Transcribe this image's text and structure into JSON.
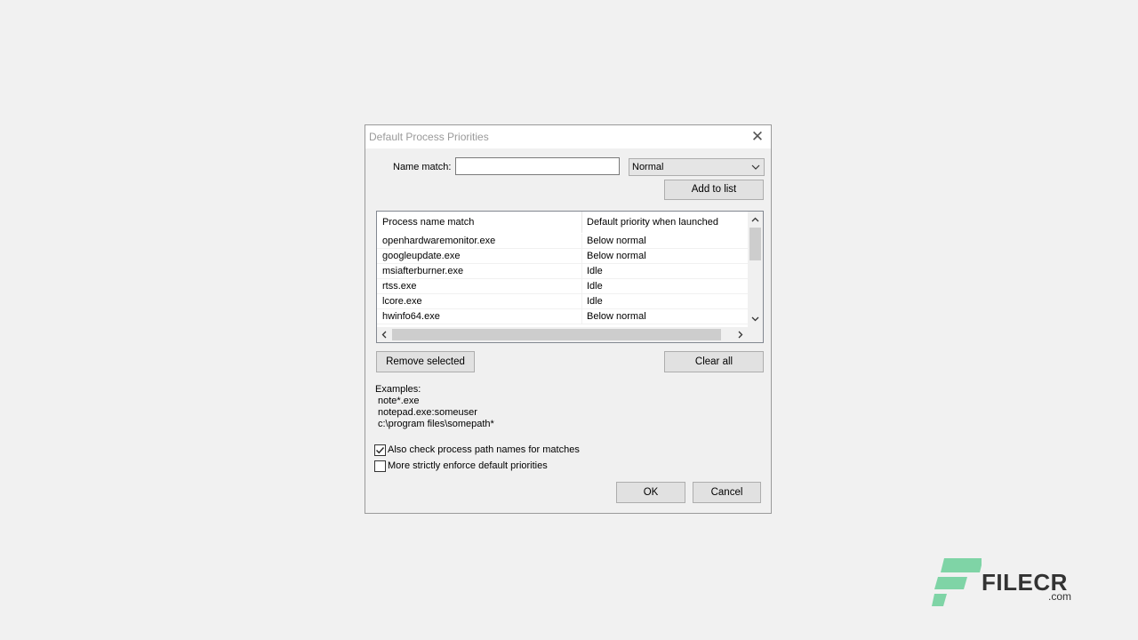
{
  "dialog": {
    "title": "Default Process Priorities",
    "name_match_label": "Name match:",
    "name_match_value": "",
    "priority_selected": "Normal",
    "add_button": "Add to list",
    "columns": [
      "Process name match",
      "Default priority when launched"
    ],
    "rows": [
      {
        "name": "openhardwaremonitor.exe",
        "priority": "Below normal"
      },
      {
        "name": "googleupdate.exe",
        "priority": "Below normal"
      },
      {
        "name": "msiafterburner.exe",
        "priority": "Idle"
      },
      {
        "name": "rtss.exe",
        "priority": "Idle"
      },
      {
        "name": "lcore.exe",
        "priority": "Idle"
      },
      {
        "name": "hwinfo64.exe",
        "priority": "Below normal"
      }
    ],
    "remove_button": "Remove selected",
    "clear_button": "Clear all",
    "examples_title": "Examples:",
    "examples": [
      "note*.exe",
      "notepad.exe:someuser",
      "c:\\program files\\somepath*"
    ],
    "check_paths_label": "Also check process path names for matches",
    "check_paths_checked": true,
    "strict_label": "More strictly enforce default priorities",
    "strict_checked": false,
    "ok_button": "OK",
    "cancel_button": "Cancel"
  },
  "watermark": {
    "brand": "FILECR",
    "domain": ".com"
  },
  "colors": {
    "accent_logo": "#7fd4a6",
    "background": "#f1f1f1"
  }
}
